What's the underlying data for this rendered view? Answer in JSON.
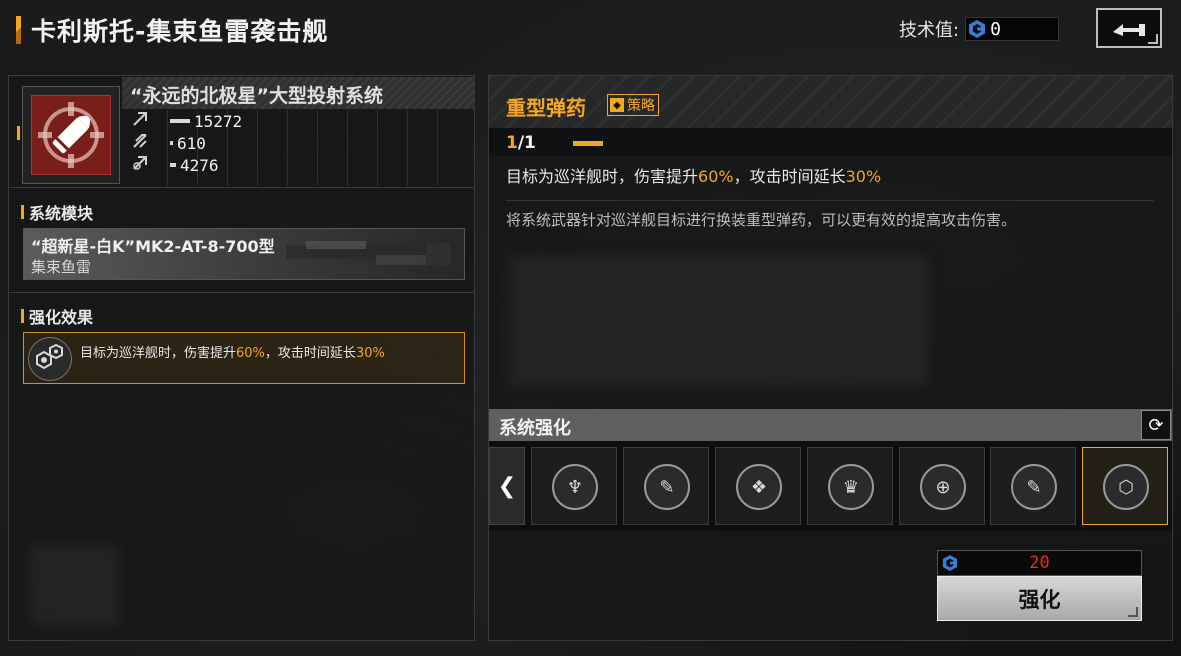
{
  "header": {
    "title": "卡利斯托-集束鱼雷袭击舰",
    "tech_label": "技术值:",
    "tech_value": "0"
  },
  "weapon": {
    "name": "“永远的北极星”大型投射系统",
    "stats": [
      {
        "icon": "damage-icon",
        "value": "15272",
        "bar_fraction": 1.0
      },
      {
        "icon": "fire-rate-icon",
        "value": "610",
        "bar_fraction": 0.04
      },
      {
        "icon": "range-icon",
        "value": "4276",
        "bar_fraction": 0.28
      }
    ]
  },
  "left": {
    "module_section": "系统模块",
    "module_name": "“超新星-白K”MK2-AT-8-700型",
    "module_type": "集束鱼雷",
    "effect_section": "强化效果",
    "effect_prefix": "目标为巡洋舰时，伤害提升",
    "effect_pct1": "60%",
    "effect_mid": "，攻击时间延长",
    "effect_pct2": "30%"
  },
  "detail": {
    "title": "重型弹药",
    "badge": "策略",
    "level_current": "1",
    "level_sep": "/1",
    "effect_prefix": "目标为巡洋舰时，伤害提升",
    "effect_pct1": "60%",
    "effect_mid": "，攻击时间延长",
    "effect_pct2": "30%",
    "description": "将系统武器针对巡洋舰目标进行换装重型弹药，可以更有效的提高攻击伤害。"
  },
  "system_upgrade": {
    "title": "系统强化",
    "prev_label": "❮",
    "refresh_label": "⟳",
    "slots": [
      {
        "icon": "armor-icon",
        "glyph": "♆"
      },
      {
        "icon": "pen-upgrade-icon",
        "glyph": "✎"
      },
      {
        "icon": "shield-icon",
        "glyph": "❖"
      },
      {
        "icon": "crown-icon",
        "glyph": "♛"
      },
      {
        "icon": "target-icon",
        "glyph": "⊕"
      },
      {
        "icon": "pen-upgrade-icon",
        "glyph": "✎"
      },
      {
        "icon": "hex-nut-icon",
        "glyph": "⬡"
      }
    ],
    "cost": "20",
    "upgrade_label": "强化"
  },
  "colors": {
    "accent": "#f5a623",
    "cost": "#e0302a",
    "weapon_icon_bg": "#7a1e1a"
  }
}
